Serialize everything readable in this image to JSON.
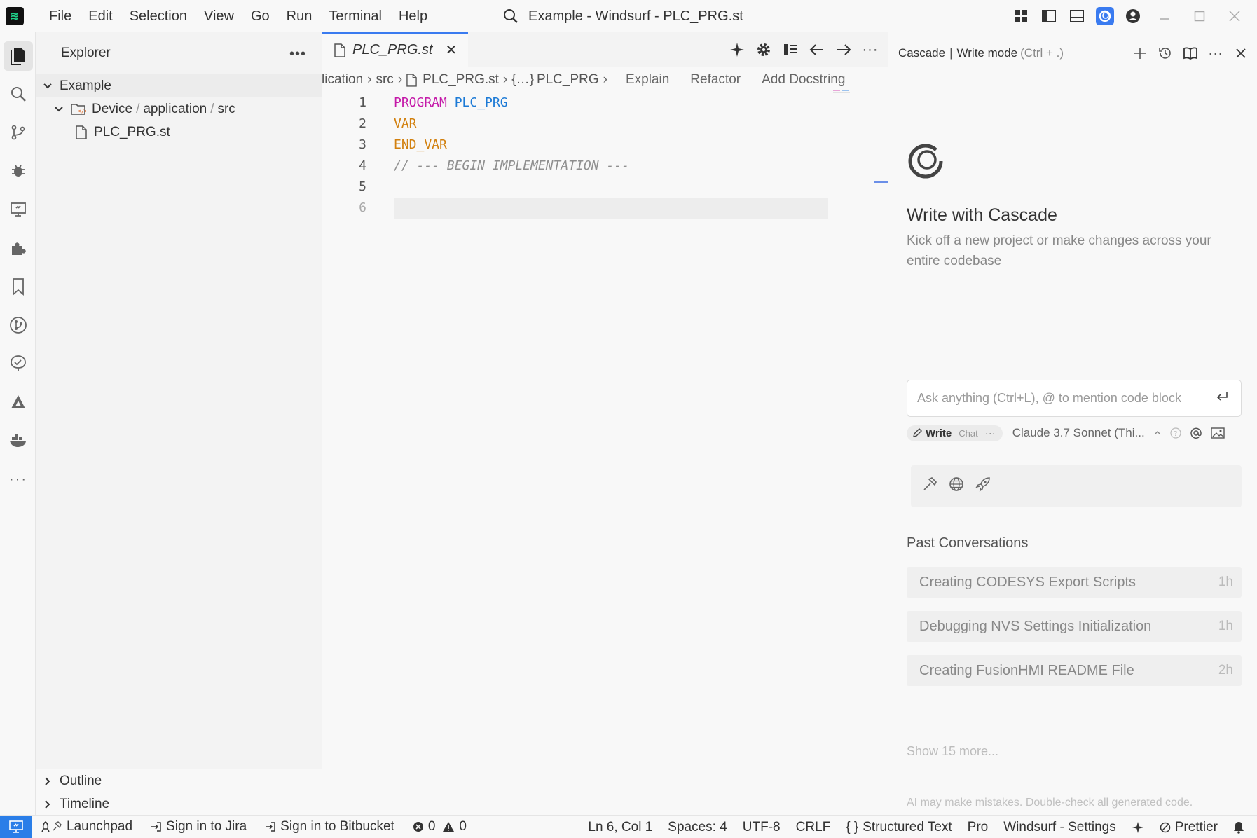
{
  "titlebar": {
    "logo": "windsurf-logo",
    "menu": [
      "File",
      "Edit",
      "Selection",
      "View",
      "Go",
      "Run",
      "Terminal",
      "Help"
    ],
    "title": "Example - Windsurf - PLC_PRG.st"
  },
  "activitybar": {
    "items": [
      "explorer-icon",
      "search-icon",
      "source-control-icon",
      "run-debug-icon",
      "remote-explorer-icon",
      "extensions-icon",
      "bookmarks-icon",
      "git-graph-icon",
      "testing-icon",
      "deploy-icon",
      "docker-icon",
      "more-icon"
    ]
  },
  "explorer": {
    "title": "Explorer",
    "more": "•••",
    "root": "Example",
    "folder": {
      "parts": [
        "Device",
        "application",
        "src"
      ],
      "sep": "/"
    },
    "file": "PLC_PRG.st",
    "outline": "Outline",
    "timeline": "Timeline"
  },
  "editor": {
    "tab": {
      "label": "PLC_PRG.st",
      "close": "✕"
    },
    "breadcrumbs": {
      "part1": "lication",
      "part2": "src",
      "part3": "PLC_PRG.st",
      "part4": "PLC_PRG",
      "lens": [
        "Explain",
        "Refactor",
        "Add Docstring"
      ]
    },
    "lines": {
      "n": [
        "1",
        "2",
        "3",
        "4",
        "5",
        "6"
      ],
      "l1a": "PROGRAM",
      "l1b": "PLC_PRG",
      "l2": "VAR",
      "l3": "END_VAR",
      "l4": "// --- BEGIN IMPLEMENTATION ---"
    },
    "current_line": 6
  },
  "cascade": {
    "header": "Cascade",
    "header_sep": "|",
    "mode_label": "Write mode",
    "shortcut": "(Ctrl + .)",
    "title": "Write with Cascade",
    "subtitle": "Kick off a new project or make changes across your entire codebase",
    "input_placeholder": "Ask anything (Ctrl+L), @ to mention code block",
    "mode_write": "Write",
    "mode_chat": "Chat",
    "mode_more": "···",
    "model": "Claude 3.7 Sonnet (Thi...",
    "past_title": "Past Conversations",
    "conversations": [
      {
        "title": "Creating CODESYS Export Scripts",
        "ago": "1h"
      },
      {
        "title": "Debugging NVS Settings Initialization",
        "ago": "1h"
      },
      {
        "title": "Creating FusionHMI README File",
        "ago": "2h"
      }
    ],
    "show_more": "Show 15 more...",
    "disclaimer": "AI may make mistakes. Double-check all generated code."
  },
  "statusbar": {
    "launchpad": "Launchpad",
    "jira": "Sign in to Jira",
    "bitbucket": "Sign in to Bitbucket",
    "errors": "0",
    "warnings": "0",
    "position": "Ln 6, Col 1",
    "spaces": "Spaces: 4",
    "encoding": "UTF-8",
    "eol": "CRLF",
    "language": "Structured Text",
    "plan": "Pro",
    "settings": "Windsurf - Settings",
    "prettier": "Prettier"
  },
  "colors": {
    "accent": "#3a7bf0",
    "keyword_pink": "#c418a8",
    "keyword_blue": "#1c7ad6",
    "keyword_orange": "#d2800e",
    "remote": "#2a7ee8"
  }
}
